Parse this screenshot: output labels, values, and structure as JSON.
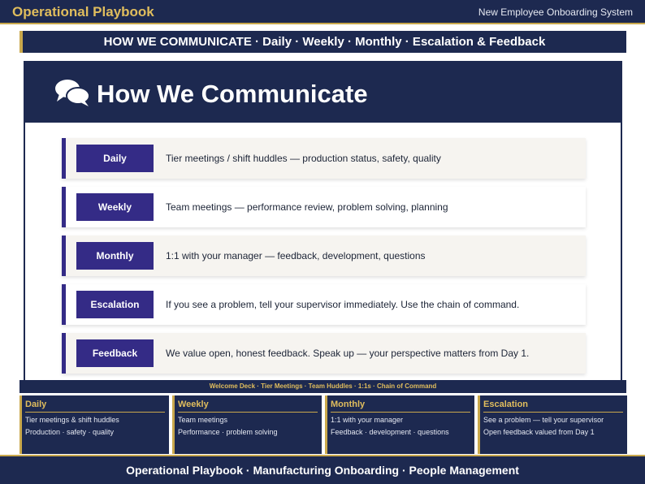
{
  "header": {
    "brand": "Operational Playbook",
    "system": "New Employee Onboarding System"
  },
  "strip": {
    "text": "HOW WE COMMUNICATE  ·  Daily · Weekly · Monthly  ·  Escalation & Feedback"
  },
  "hero": {
    "title": "How We Communicate",
    "icon": "chat-bubbles-icon"
  },
  "rows": [
    {
      "label": "Daily",
      "text": "Tier meetings / shift huddles — production status, safety, quality"
    },
    {
      "label": "Weekly",
      "text": "Team meetings — performance review, problem solving, planning"
    },
    {
      "label": "Monthly",
      "text": "1:1 with your manager — feedback, development, questions"
    },
    {
      "label": "Escalation",
      "text": "If you see a problem, tell your supervisor immediately. Use the chain of command."
    },
    {
      "label": "Feedback",
      "text": "We value open, honest feedback. Speak up — your perspective matters from Day 1."
    }
  ],
  "mini_bar": {
    "text": "Welcome Deck · Tier Meetings · Team Huddles · 1:1s · Chain of Command"
  },
  "cards": [
    {
      "title": "Daily",
      "line1": "Tier meetings & shift huddles",
      "line2": "Production · safety · quality"
    },
    {
      "title": "Weekly",
      "line1": "Team meetings",
      "line2": "Performance · problem solving"
    },
    {
      "title": "Monthly",
      "line1": "1:1 with your manager",
      "line2": "Feedback · development · questions"
    },
    {
      "title": "Escalation",
      "line1": "See a problem — tell your supervisor",
      "line2": "Open feedback valued from Day 1"
    }
  ],
  "footer": {
    "text": "Operational Playbook  ·  Manufacturing Onboarding  ·  People Management"
  },
  "colors": {
    "navy": "#1d2950",
    "gold": "#c9a84c",
    "purple": "#342b86",
    "row_light": "#f6f4f0"
  }
}
